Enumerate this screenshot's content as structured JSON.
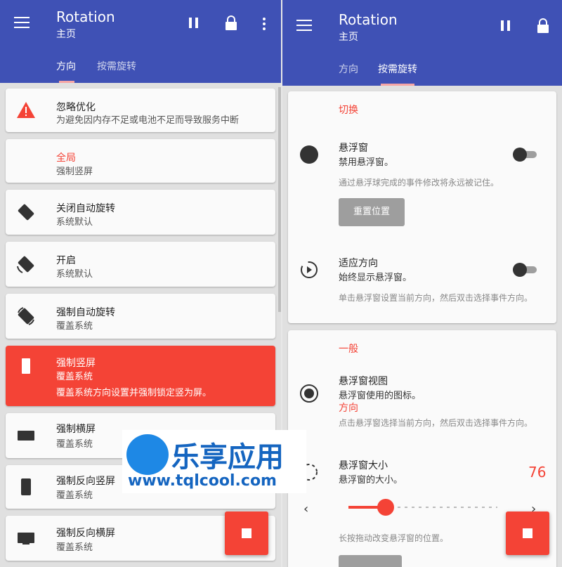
{
  "left": {
    "app_title": "Rotation",
    "app_subtitle": "主页",
    "tabs": [
      {
        "label": "方向"
      },
      {
        "label": "按需旋转"
      }
    ],
    "items": [
      {
        "title": "忽略优化",
        "summary": "为避免因内存不足或电池不足而导致服务中断"
      },
      {
        "title": "全局",
        "summary": "强制竖屏"
      },
      {
        "title": "关闭自动旋转",
        "summary": "系统默认"
      },
      {
        "title": "开启",
        "summary": "系统默认"
      },
      {
        "title": "强制自动旋转",
        "summary": "覆盖系统"
      },
      {
        "title": "强制竖屏",
        "summary": "覆盖系统",
        "extra": "覆盖系统方向设置并强制锁定竖为屏。"
      },
      {
        "title": "强制横屏",
        "summary": "覆盖系统"
      },
      {
        "title": "强制反向竖屏",
        "summary": "覆盖系统"
      },
      {
        "title": "强制反向横屏",
        "summary": "覆盖系统"
      }
    ]
  },
  "right": {
    "app_title": "Rotation",
    "app_subtitle": "主页",
    "tabs": [
      {
        "label": "方向"
      },
      {
        "label": "按需旋转"
      }
    ],
    "section1": {
      "header": "切换",
      "floating": {
        "title": "悬浮窗",
        "summary": "禁用悬浮窗。",
        "hint": "通过悬浮球完成的事件修改将永远被记住。",
        "button": "重置位置"
      },
      "adapt": {
        "title": "适应方向",
        "summary": "始终显示悬浮窗。",
        "hint": "单击悬浮窗设置当前方向，然后双击选择事件方向。"
      }
    },
    "section2": {
      "header": "一般",
      "view": {
        "title": "悬浮窗视图",
        "summary": "悬浮窗使用的图标。",
        "value": "方向",
        "hint": "点击悬浮窗选择当前方向，然后双击选择事件方向。"
      },
      "size": {
        "title": "悬浮窗大小",
        "summary": "悬浮窗的大小。",
        "value": "76",
        "level": 0.25,
        "hint": "长按拖动改变悬浮窗的位置。"
      }
    }
  },
  "watermark": {
    "cn": "乐享应用",
    "en": "www.tqlcool.com"
  },
  "colors": {
    "primary": "#3f51b5",
    "accent": "#f44336",
    "card": "#fafafa"
  }
}
